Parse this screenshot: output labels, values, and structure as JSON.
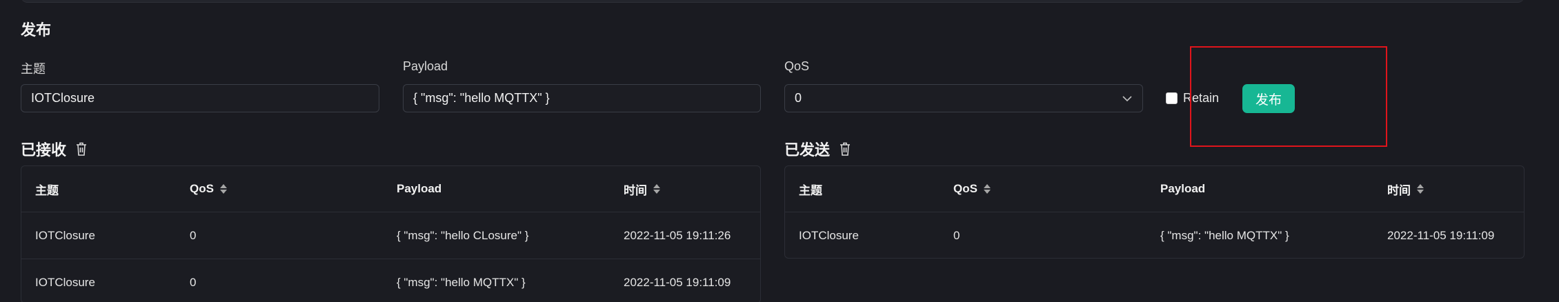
{
  "publish": {
    "title": "发布",
    "topic_label": "主题",
    "topic_value": "IOTClosure",
    "payload_label": "Payload",
    "payload_value": "{ \"msg\": \"hello MQTTX\" }",
    "qos_label": "QoS",
    "qos_value": "0",
    "retain_label": "Retain",
    "retain_checked": false,
    "publish_button": "发布"
  },
  "received": {
    "title": "已接收",
    "columns": [
      "主题",
      "QoS",
      "Payload",
      "时间"
    ],
    "rows": [
      {
        "topic": "IOTClosure",
        "qos": "0",
        "payload": "{ \"msg\": \"hello CLosure\" }",
        "time": "2022-11-05 19:11:26"
      },
      {
        "topic": "IOTClosure",
        "qos": "0",
        "payload": "{ \"msg\": \"hello MQTTX\" }",
        "time": "2022-11-05 19:11:09"
      }
    ]
  },
  "sent": {
    "title": "已发送",
    "columns": [
      "主题",
      "QoS",
      "Payload",
      "时间"
    ],
    "rows": [
      {
        "topic": "IOTClosure",
        "qos": "0",
        "payload": "{ \"msg\": \"hello MQTTX\" }",
        "time": "2022-11-05 19:11:09"
      }
    ]
  },
  "colors": {
    "accent": "#17b794",
    "background": "#1a1b21",
    "highlight": "#e0141b"
  }
}
